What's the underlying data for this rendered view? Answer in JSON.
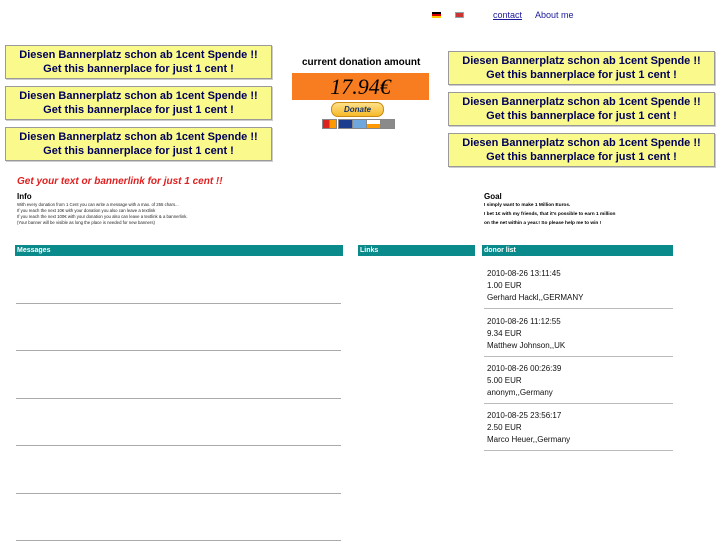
{
  "nav": {
    "contact": "contact",
    "about": "About me"
  },
  "banner": {
    "line1": "Diesen Bannerplatz schon ab 1cent Spende !!",
    "line2": "Get this bannerplace for just 1 cent !"
  },
  "donation": {
    "title": "current donation amount",
    "amount": "17.94€",
    "donate_label": "Donate"
  },
  "cta": "Get your text or bannerlink for just 1 cent !!",
  "info": {
    "heading": "Info",
    "lines": [
      "With every donation from 1 Cent you can write a message with a max. of 255 chars...",
      "If you reach the next 10€ with your donation you also can leave a textlink",
      "If you reach the next 100€ with your donation you also can leave a textlink & a bannerlink.",
      "(Your banner will be visible as long the place is needed for new banners)"
    ]
  },
  "goal": {
    "heading": "Goal",
    "lines": [
      "I simply want to make 1 Million Euros.",
      "I bet 1€ with my friends, that it's possible to earn 1 million",
      "on the net within a year.! So please help me to win !"
    ]
  },
  "sections": {
    "messages": "Messages",
    "links": "Links",
    "donors": "donor list"
  },
  "donors": [
    {
      "date": "2010-08-26 13:11:45",
      "amount": "1.00 EUR",
      "name": "Gerhard Hackl,,GERMANY"
    },
    {
      "date": "2010-08-26 11:12:55",
      "amount": "9.34 EUR",
      "name": "Matthew Johnson,,UK"
    },
    {
      "date": "2010-08-26 00:26:39",
      "amount": "5.00 EUR",
      "name": "anonym,,Germany"
    },
    {
      "date": "2010-08-25 23:56:17",
      "amount": "2.50 EUR",
      "name": "Marco Heuer,,Germany"
    }
  ],
  "colors": {
    "banner_bg": "#fafa8c",
    "amount_bg": "#f77d20",
    "section_bar": "#0a8a8a",
    "cta": "#e02020"
  },
  "icons": {
    "flag_de": "german-flag-icon",
    "flag_en": "uk-flag-icon"
  }
}
